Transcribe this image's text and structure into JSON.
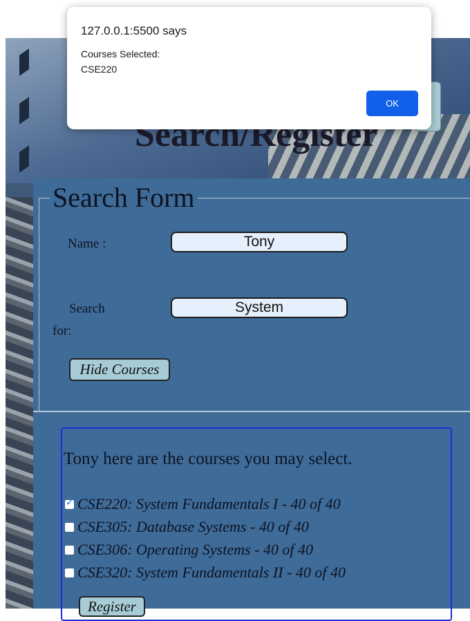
{
  "dialog": {
    "origin": "127.0.0.1:5500 says",
    "message_line1": "Courses Selected:",
    "message_line2": "CSE220",
    "ok_label": "OK"
  },
  "page": {
    "heading": "Search/Register"
  },
  "form": {
    "legend": "Search Form",
    "name_label": "Name :",
    "name_value": "Tony",
    "search_label_line1": "Search",
    "search_label_line2": "for:",
    "search_value": "System",
    "hide_button": "Hide Courses"
  },
  "courses": {
    "intro": "Tony here are the courses you may select.",
    "items": [
      {
        "label": "CSE220: System Fundamentals I - 40 of 40",
        "checked": true
      },
      {
        "label": "CSE305: Database Systems - 40 of 40",
        "checked": false
      },
      {
        "label": "CSE306: Operating Systems - 40 of 40",
        "checked": false
      },
      {
        "label": "CSE320: System Fundamentals II - 40 of 40",
        "checked": false
      }
    ],
    "register_button": "Register"
  },
  "colors": {
    "panel": "#3f6b99",
    "button": "#a8ccd6",
    "ok_button": "#1260ea",
    "course_border": "#1a2fd6"
  }
}
